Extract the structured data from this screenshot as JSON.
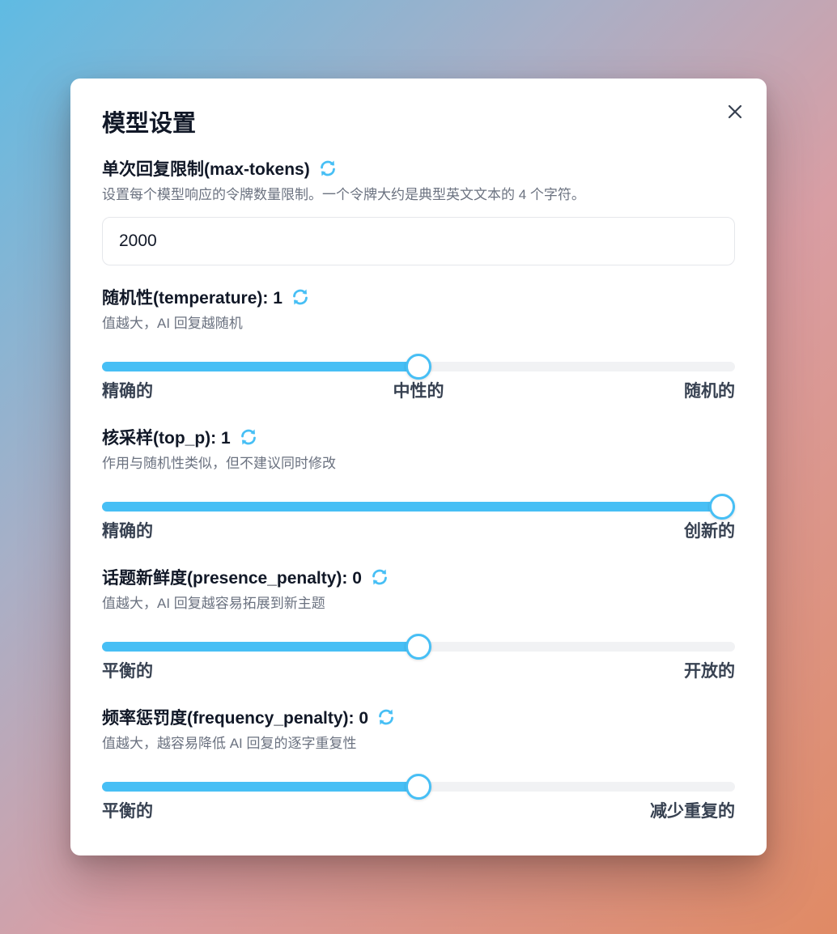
{
  "modal": {
    "title": "模型设置"
  },
  "colors": {
    "accent": "#47bff5",
    "track": "#f1f2f4"
  },
  "max_tokens": {
    "label": "单次回复限制(max-tokens)",
    "description": "设置每个模型响应的令牌数量限制。一个令牌大约是典型英文文本的 4 个字符。",
    "value": "2000",
    "icon": "refresh-icon"
  },
  "temperature": {
    "label": "随机性(temperature): 1",
    "description": "值越大，AI 回复越随机",
    "fraction": 0.5,
    "marks": {
      "left": "精确的",
      "center": "中性的",
      "right": "随机的"
    }
  },
  "top_p": {
    "label": "核采样(top_p): 1",
    "description": "作用与随机性类似，但不建议同时修改",
    "fraction": 1.0,
    "marks": {
      "left": "精确的",
      "right": "创新的"
    }
  },
  "presence_penalty": {
    "label": "话题新鲜度(presence_penalty): 0",
    "description": "值越大，AI 回复越容易拓展到新主题",
    "fraction": 0.5,
    "marks": {
      "left": "平衡的",
      "right": "开放的"
    }
  },
  "frequency_penalty": {
    "label": "频率惩罚度(frequency_penalty): 0",
    "description": "值越大，越容易降低 AI 回复的逐字重复性",
    "fraction": 0.5,
    "marks": {
      "left": "平衡的",
      "right": "减少重复的"
    }
  }
}
